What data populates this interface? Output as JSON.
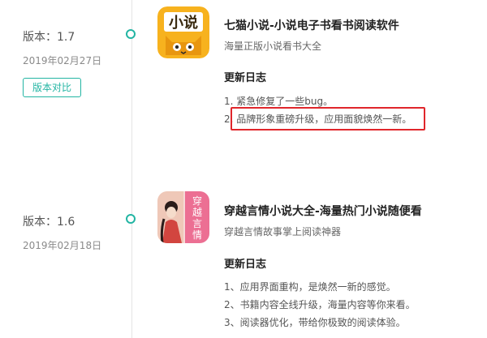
{
  "entries": [
    {
      "version": "版本：1.7",
      "date": "2019年02月27日",
      "compare_button": "版本对比",
      "app_title": "七猫小说-小说电子书看书阅读软件",
      "app_subtitle": "海量正版小说看书大全",
      "log_heading": "更新日志",
      "log_items": [
        "1. 紧急修复了一些bug。",
        "2. 品牌形象重磅升级，应用面貌焕然一新。"
      ],
      "icon": {
        "name": "qimao-app-icon",
        "text": "小说",
        "bg": "#f7b21e"
      }
    },
    {
      "version": "版本：1.6",
      "date": "2019年02月18日",
      "app_title": "穿越言情小说大全-海量热门小说随便看",
      "app_subtitle": "穿越言情故事掌上阅读神器",
      "log_heading": "更新日志",
      "log_items": [
        "1、应用界面重构，是焕然一新的感觉。",
        "2、书籍内容全线升级，海量内容等你来看。",
        "3、阅读器优化，带给你极致的阅读体验。"
      ],
      "icon": {
        "name": "chuanyue-app-icon",
        "text": "穿越言情",
        "bg": "#f06a8f"
      }
    }
  ],
  "colors": {
    "accent": "#23b5a3",
    "highlight": "#e0262b",
    "qimao_yellow": "#f7b21e",
    "romance_pink": "#f06a8f"
  }
}
